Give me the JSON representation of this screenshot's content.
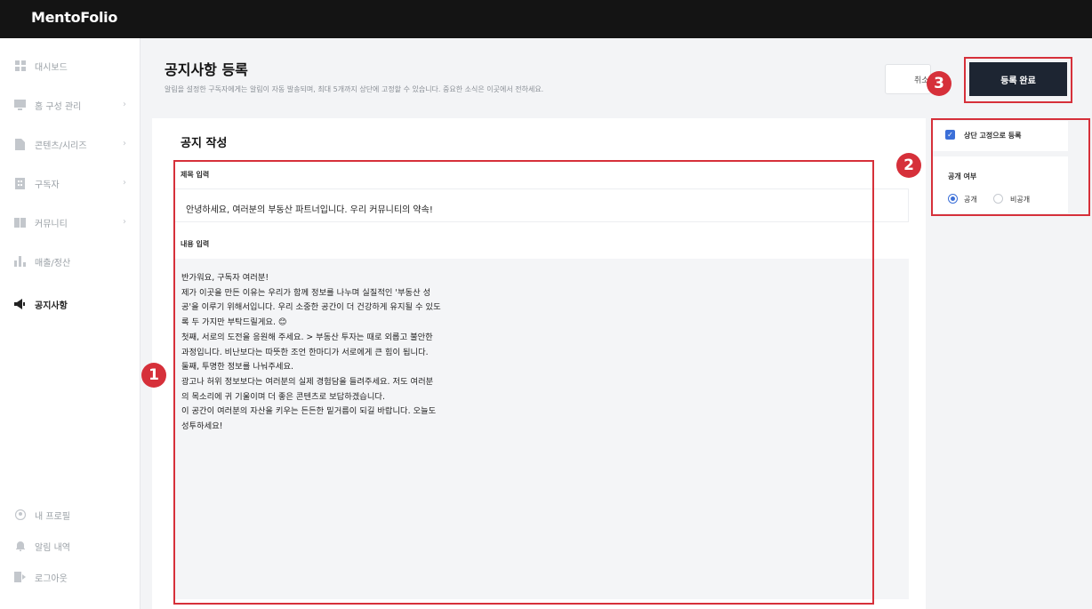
{
  "app": {
    "brand": "MentoFolio"
  },
  "sidebar": {
    "items": [
      {
        "label": "대시보드",
        "icon": "grid-icon",
        "chevron": false,
        "active": false
      },
      {
        "label": "홈 구성 관리",
        "icon": "monitor-icon",
        "chevron": true,
        "active": false
      },
      {
        "label": "콘텐츠/시리즈",
        "icon": "file-icon",
        "chevron": true,
        "active": false
      },
      {
        "label": "구독자",
        "icon": "building-icon",
        "chevron": true,
        "active": false
      },
      {
        "label": "커뮤니티",
        "icon": "book-icon",
        "chevron": true,
        "active": false
      },
      {
        "label": "매출/정산",
        "icon": "bar-chart-icon",
        "chevron": false,
        "active": false
      },
      {
        "label": "공지사항",
        "icon": "megaphone-icon",
        "chevron": false,
        "active": true
      }
    ],
    "bottom": [
      {
        "label": "내 프로필",
        "icon": "user-icon"
      },
      {
        "label": "알림 내역",
        "icon": "bell-icon"
      },
      {
        "label": "로그아웃",
        "icon": "logout-icon"
      }
    ]
  },
  "header": {
    "title": "공지사항 등록",
    "description": "알림을 설정한 구독자에게는 알림이 자동 발송되며, 최대 5개까지 상단에 고정할 수 있습니다. 중요한 소식은 이곳에서 전하세요.",
    "cancel_label": "취소",
    "submit_label": "등록 완료"
  },
  "editor": {
    "card_title": "공지 작성",
    "title_label": "제목 입력",
    "title_value": "안녕하세요, 여러분의 부동산 파트너입니다. 우리 커뮤니티의 약속!",
    "content_label": "내용 입력",
    "content_value": "반가워요, 구독자 여러분!\n제가 이곳을 만든 이유는 우리가 함께 정보를 나누며 실질적인 '부동산 성\n공'을 이루기 위해서입니다. 우리 소중한 공간이 더 건강하게 유지될 수 있도\n록 두 가지만 부탁드릴게요. 😊\n첫째, 서로의 도전을 응원해 주세요. > 부동산 투자는 때로 외롭고 불안한\n과정입니다. 비난보다는 따뜻한 조언 한마디가 서로에게 큰 힘이 됩니다.\n둘째, 투명한 정보를 나눠주세요.\n광고나 허위 정보보다는 여러분의 실제 경험담을 들려주세요. 저도 여러분\n의 목소리에 귀 기울이며 더 좋은 콘텐츠로 보답하겠습니다.\n이 공간이 여러분의 자산을 키우는 든든한 밑거름이 되길 바랍니다. 오늘도\n성투하세요!"
  },
  "options": {
    "pin_label": "상단 고정으로 등록",
    "pin_checked": true,
    "visibility_label": "공개 여부",
    "public_label": "공개",
    "private_label": "비공개",
    "selected": "public"
  },
  "annotations": {
    "one": "1",
    "two": "2",
    "three": "3",
    "color": "#d6303a"
  },
  "colors": {
    "accent": "#3b6fd8",
    "submit_bg": "#1d2532",
    "topbar": "#141414"
  }
}
